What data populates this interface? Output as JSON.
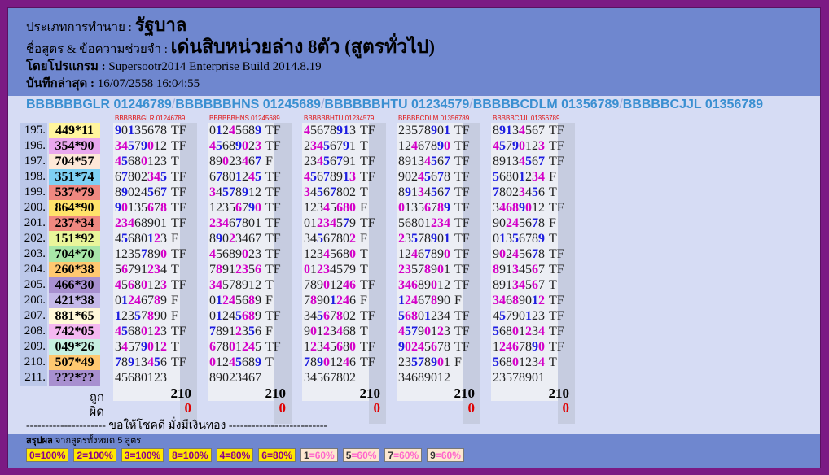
{
  "header": {
    "type_label": "ประเภทการทำนาย :",
    "type_value": "รัฐบาล",
    "formula_label": "ชื่อสูตร & ข้อความช่วยจำ :",
    "formula_value": "เด่นสิบหน่วยล่าง 8ตัว (สูตรทั่วไป)",
    "program_label": "โดยโปรแกรม :",
    "program_value": "Supersootr2014 Enterprise Build 2014.8.19",
    "saved_label": "บันทึกล่าสุด :",
    "saved_value": "16/07/2558 16:04:55"
  },
  "formulas": [
    "BBBBBBGLR 01246789",
    "BBBBBBHNS 01245689",
    "BBBBBBHTU 01234579",
    "BBBBBCDLM 01356789",
    "BBBBBCJJL 01356789"
  ],
  "columns": [
    {
      "head": "BBBBBBGLR 01246789",
      "correct": "210",
      "wrong": "0"
    },
    {
      "head": "BBBBBBHNS 01245689",
      "correct": "210",
      "wrong": "0"
    },
    {
      "head": "BBBBBBHTU 01234579",
      "correct": "210",
      "wrong": "0"
    },
    {
      "head": "BBBBBCDLM 01356789",
      "correct": "210",
      "wrong": "0"
    },
    {
      "head": "BBBBBCJJL 01356789",
      "correct": "210",
      "wrong": "0"
    }
  ],
  "rows": [
    {
      "idx": "195.",
      "res": "449*11",
      "color": "#fff59d",
      "cells": [
        [
          "90135678",
          "TF"
        ],
        [
          "01245689",
          "TF"
        ],
        [
          "45678913",
          "TF"
        ],
        [
          "23578901",
          "TF"
        ],
        [
          "89134567",
          "TF"
        ]
      ]
    },
    {
      "idx": "196.",
      "res": "354*90",
      "color": "#e9a8ee",
      "cells": [
        [
          "34579012",
          "TF"
        ],
        [
          "45689023",
          "TF"
        ],
        [
          "23456791",
          "T"
        ],
        [
          "12467890",
          "TF"
        ],
        [
          "45790123",
          "TF"
        ]
      ]
    },
    {
      "idx": "197.",
      "res": "704*57",
      "color": "#fde8d8",
      "cells": [
        [
          "45680123",
          "T"
        ],
        [
          "89023467",
          "F"
        ],
        [
          "23456791",
          "TF"
        ],
        [
          "89134567",
          "TF"
        ],
        [
          "89134567",
          "TF"
        ]
      ]
    },
    {
      "idx": "198.",
      "res": "351*74",
      "color": "#7ed0f4",
      "cells": [
        [
          "67802345",
          "TF"
        ],
        [
          "67801245",
          "TF"
        ],
        [
          "45678913",
          "TF"
        ],
        [
          "90245678",
          "TF"
        ],
        [
          "56801234",
          "F"
        ]
      ]
    },
    {
      "idx": "199.",
      "res": "537*79",
      "color": "#ef8880",
      "cells": [
        [
          "89024567",
          "TF"
        ],
        [
          "34578912",
          "TF"
        ],
        [
          "34567802",
          "T"
        ],
        [
          "89134567",
          "TF"
        ],
        [
          "78023456",
          "T"
        ]
      ]
    },
    {
      "idx": "200.",
      "res": "864*90",
      "color": "#ffe36a",
      "cells": [
        [
          "90135678",
          "TF"
        ],
        [
          "12356790",
          "TF"
        ],
        [
          "12345680",
          "F"
        ],
        [
          "01356789",
          "TF"
        ],
        [
          "34689012",
          "TF"
        ]
      ]
    },
    {
      "idx": "201.",
      "res": "237*34",
      "color": "#ef8880",
      "cells": [
        [
          "23468901",
          "TF"
        ],
        [
          "23467801",
          "TF"
        ],
        [
          "01234579",
          "TF"
        ],
        [
          "56801234",
          "TF"
        ],
        [
          "90245678",
          "F"
        ]
      ]
    },
    {
      "idx": "202.",
      "res": "151*92",
      "color": "#e9f59a",
      "cells": [
        [
          "45680123",
          "F"
        ],
        [
          "89023467",
          "TF"
        ],
        [
          "34567802",
          "F"
        ],
        [
          "23578901",
          "TF"
        ],
        [
          "01356789",
          "T"
        ]
      ]
    },
    {
      "idx": "203.",
      "res": "704*70",
      "color": "#a8e6a8",
      "cells": [
        [
          "12357890",
          "TF"
        ],
        [
          "45689023",
          "TF"
        ],
        [
          "12345680",
          "T"
        ],
        [
          "12467890",
          "TF"
        ],
        [
          "90245678",
          "TF"
        ]
      ]
    },
    {
      "idx": "204.",
      "res": "260*38",
      "color": "#ffc870",
      "cells": [
        [
          "56791234",
          "T"
        ],
        [
          "78912356",
          "TF"
        ],
        [
          "01234579",
          "T"
        ],
        [
          "23578901",
          "TF"
        ],
        [
          "89134567",
          "TF"
        ]
      ]
    },
    {
      "idx": "205.",
      "res": "466*30",
      "color": "#a890d0",
      "cells": [
        [
          "45680123",
          "TF"
        ],
        [
          "34578912",
          "T"
        ],
        [
          "78901246",
          "TF"
        ],
        [
          "34689012",
          "TF"
        ],
        [
          "89134567",
          "T"
        ]
      ]
    },
    {
      "idx": "206.",
      "res": "421*38",
      "color": "#c4b8e8",
      "cells": [
        [
          "01246789",
          "F"
        ],
        [
          "01245689",
          "F"
        ],
        [
          "78901246",
          "F"
        ],
        [
          "12467890",
          "F"
        ],
        [
          "34689012",
          "TF"
        ]
      ]
    },
    {
      "idx": "207.",
      "res": "881*65",
      "color": "#fff8d8",
      "cells": [
        [
          "12357890",
          "F"
        ],
        [
          "01245689",
          "TF"
        ],
        [
          "34567802",
          "TF"
        ],
        [
          "56801234",
          "TF"
        ],
        [
          "45790123",
          "TF"
        ]
      ]
    },
    {
      "idx": "208.",
      "res": "742*05",
      "color": "#f4b8f0",
      "cells": [
        [
          "45680123",
          "TF"
        ],
        [
          "78912356",
          "F"
        ],
        [
          "90123468",
          "T"
        ],
        [
          "45790123",
          "TF"
        ],
        [
          "56801234",
          "TF"
        ]
      ]
    },
    {
      "idx": "209.",
      "res": "049*26",
      "color": "#c6f0e0",
      "cells": [
        [
          "34579012",
          "T"
        ],
        [
          "67801245",
          "TF"
        ],
        [
          "12345680",
          "TF"
        ],
        [
          "90245678",
          "TF"
        ],
        [
          "12467890",
          "TF"
        ]
      ]
    },
    {
      "idx": "210.",
      "res": "507*49",
      "color": "#ffc870",
      "cells": [
        [
          "78913456",
          "TF"
        ],
        [
          "01245689",
          "T"
        ],
        [
          "78901246",
          "TF"
        ],
        [
          "23578901",
          "F"
        ],
        [
          "56801234",
          "T"
        ]
      ]
    },
    {
      "idx": "211.",
      "res": "???*??",
      "color": "#a890d0",
      "cells": [
        [
          "45680123",
          ""
        ],
        [
          "89023467",
          ""
        ],
        [
          "34567802",
          ""
        ],
        [
          "34689012",
          ""
        ],
        [
          "23578901",
          ""
        ]
      ]
    }
  ],
  "summary": {
    "correct_label": "ถูก",
    "wrong_label": "ผิด"
  },
  "blessing": "--------------------- ขอให้โชคดี มั่งมีเงินทอง --------------------------",
  "footer": {
    "title": "สรุปผล",
    "subtitle": "จากสูตรทั้งหมด 5 สูตร",
    "badges": [
      {
        "digit": "0",
        "pct": "100%",
        "level": "high"
      },
      {
        "digit": "2",
        "pct": "100%",
        "level": "high"
      },
      {
        "digit": "3",
        "pct": "100%",
        "level": "high"
      },
      {
        "digit": "8",
        "pct": "100%",
        "level": "high"
      },
      {
        "digit": "4",
        "pct": "80%",
        "level": "high"
      },
      {
        "digit": "6",
        "pct": "80%",
        "level": "high"
      },
      {
        "digit": "1",
        "pct": "60%",
        "level": "low"
      },
      {
        "digit": "5",
        "pct": "60%",
        "level": "low"
      },
      {
        "digit": "7",
        "pct": "60%",
        "level": "low"
      },
      {
        "digit": "9",
        "pct": "60%",
        "level": "low"
      }
    ]
  }
}
